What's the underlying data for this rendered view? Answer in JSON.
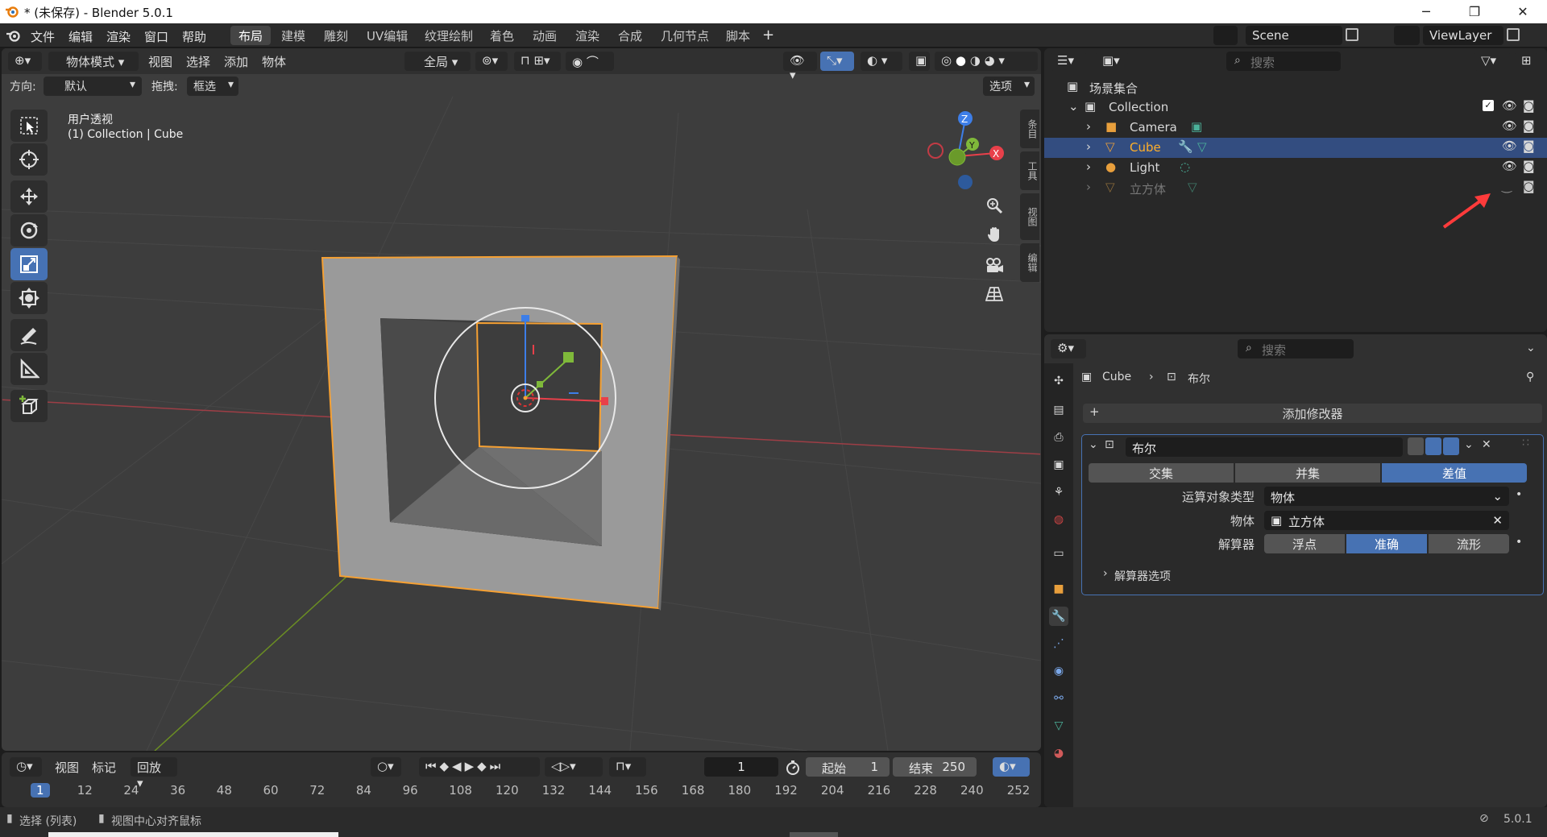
{
  "window": {
    "title": "* (未保存) - Blender 5.0.1",
    "minimize": "─",
    "restore": "❐",
    "close": "✕"
  },
  "topbar": {
    "menus": [
      "文件",
      "编辑",
      "渲染",
      "窗口",
      "帮助"
    ],
    "workspaces": [
      "布局",
      "建模",
      "雕刻",
      "UV编辑",
      "纹理绘制",
      "着色",
      "动画",
      "渲染",
      "合成",
      "几何节点",
      "脚本"
    ],
    "active_workspace": "布局",
    "add_tab": "+",
    "scene": "Scene",
    "view_layer": "ViewLayer"
  },
  "viewport": {
    "mode": "物体模式",
    "menus": [
      "视图",
      "选择",
      "添加",
      "物体"
    ],
    "transform_orientation": "全局",
    "orientation_label": "方向:",
    "orientation_value": "默认",
    "drag_label": "拖拽:",
    "drag_value": "框选",
    "options": "选项",
    "view_name": "用户透视",
    "collection_line": "(1) Collection | Cube",
    "side_tabs": [
      "条目",
      "工具",
      "视图",
      "编辑"
    ],
    "gizmo": {
      "z": "Z",
      "y": "Y",
      "x": "X"
    },
    "tools": [
      "select-box-icon",
      "cursor-icon",
      "move-icon",
      "rotate-icon",
      "scale-icon",
      "transform-icon",
      "annotate-icon",
      "measure-icon",
      "add-cube-icon"
    ],
    "active_tool": "scale-icon"
  },
  "timeline": {
    "menus": [
      "视图",
      "标记"
    ],
    "playback": "回放",
    "current_frame": "1",
    "start_label": "起始",
    "start": "1",
    "end_label": "结束",
    "end": "250",
    "frame_ticks": [
      "1",
      "12",
      "24",
      "36",
      "48",
      "60",
      "72",
      "84",
      "96",
      "108",
      "120",
      "132",
      "144",
      "156",
      "168",
      "180",
      "192",
      "204",
      "216",
      "228",
      "240",
      "252"
    ]
  },
  "status": {
    "left1": "选择 (列表)",
    "left2": "视图中心对齐鼠标",
    "version": "5.0.1"
  },
  "outliner": {
    "search_placeholder": "搜索",
    "scene_collection": "场景集合",
    "rows": [
      {
        "name": "Collection",
        "type": "collection"
      },
      {
        "name": "Camera",
        "type": "camera"
      },
      {
        "name": "Cube",
        "type": "mesh",
        "selected": true
      },
      {
        "name": "Light",
        "type": "light"
      },
      {
        "name": "立方体",
        "type": "mesh",
        "hidden": true
      }
    ]
  },
  "properties": {
    "search_placeholder": "搜索",
    "breadcrumb_object": "Cube",
    "breadcrumb_modifier": "布尔",
    "add_modifier": "添加修改器",
    "modifier_name": "布尔",
    "operations": [
      "交集",
      "并集",
      "差值"
    ],
    "active_operation": "差值",
    "operand_type_label": "运算对象类型",
    "operand_type_value": "物体",
    "object_label": "物体",
    "object_value": "立方体",
    "solver_label": "解算器",
    "solvers": [
      "浮点",
      "准确",
      "流形"
    ],
    "active_solver": "准确",
    "solver_options": "解算器选项"
  },
  "colors": {
    "accent": "#4772b3",
    "selected_orange": "#f5a033",
    "annotation_arrow": "#ff3b3b"
  }
}
